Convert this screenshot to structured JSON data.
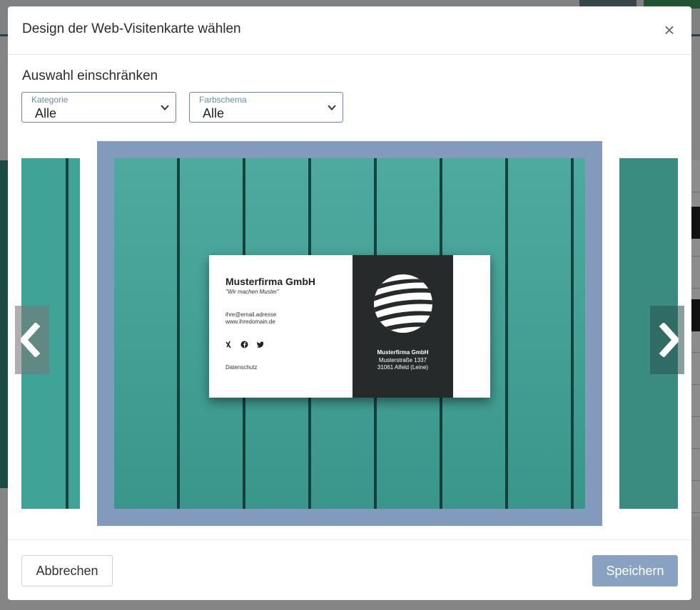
{
  "modal": {
    "title": "Design der Web-Visitenkarte wählen",
    "close_glyph": "×"
  },
  "filters": {
    "heading": "Auswahl einschränken",
    "category": {
      "label": "Kategorie",
      "value": "Alle"
    },
    "color_scheme": {
      "label": "Farbschema",
      "value": "Alle"
    }
  },
  "card_preview": {
    "company": "Musterfirma GmbH",
    "slogan": "\"Wir machen Muster\"",
    "email": "ihre@email.adresse",
    "website": "www.ihredomain.de",
    "social_icons": [
      "xing-icon",
      "facebook-icon",
      "twitter-icon"
    ],
    "privacy": "Datenschutz",
    "address_name": "Musterfirma GmbH",
    "address_street": "Musterstraße 1337",
    "address_city": "31061 Alfeld (Leine)"
  },
  "footer": {
    "cancel_label": "Abbrechen",
    "save_label": "Speichern"
  },
  "colors": {
    "accent": "#8aa2c2",
    "selected_frame": "#829bbd",
    "teal": "#3fa397"
  }
}
